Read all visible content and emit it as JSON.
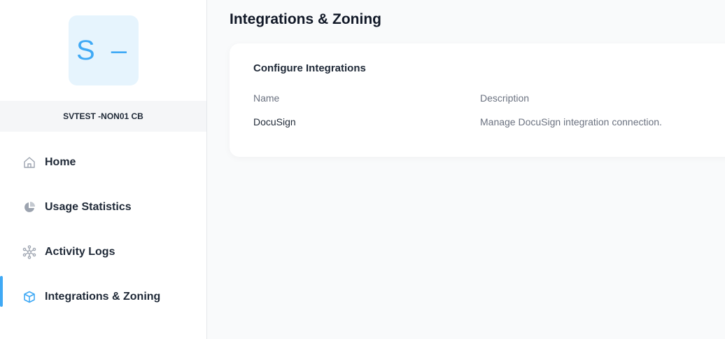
{
  "sidebar": {
    "avatar_initials": "S –",
    "org_name": "SVTEST -NON01 CB",
    "items": [
      {
        "label": "Home",
        "icon": "home-icon",
        "active": false
      },
      {
        "label": "Usage Statistics",
        "icon": "pie-chart-icon",
        "active": false
      },
      {
        "label": "Activity Logs",
        "icon": "network-icon",
        "active": false
      },
      {
        "label": "Integrations & Zoning",
        "icon": "cube-icon",
        "active": true
      }
    ]
  },
  "main": {
    "title": "Integrations & Zoning",
    "card": {
      "title": "Configure Integrations",
      "columns": [
        "Name",
        "Description"
      ],
      "rows": [
        {
          "name": "DocuSign",
          "description": "Manage DocuSign integration connection."
        }
      ]
    }
  },
  "colors": {
    "accent": "#3fa9f5",
    "avatar_bg": "#e6f4fd",
    "text_muted": "#6b7280"
  }
}
